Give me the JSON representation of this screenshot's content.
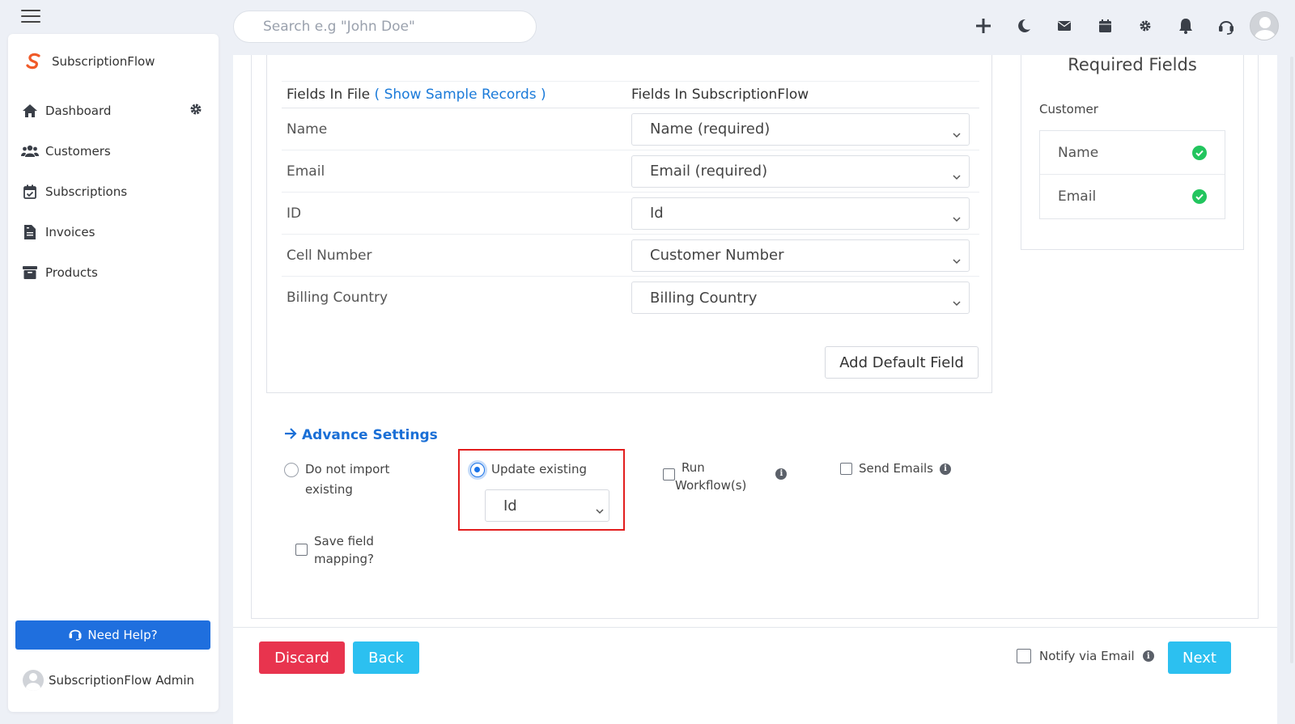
{
  "brand": {
    "name": "SubscriptionFlow",
    "accent": "#f05a28"
  },
  "search": {
    "placeholder": "Search e.g \"John Doe\""
  },
  "sidebar": {
    "items": [
      {
        "label": "Dashboard",
        "icon": "home-icon"
      },
      {
        "label": "Customers",
        "icon": "users-icon"
      },
      {
        "label": "Subscriptions",
        "icon": "calendar-check-icon"
      },
      {
        "label": "Invoices",
        "icon": "invoice-icon"
      },
      {
        "label": "Products",
        "icon": "archive-icon"
      }
    ],
    "help_label": "Need Help?",
    "admin_name": "SubscriptionFlow Admin"
  },
  "mapping": {
    "head_file": "Fields In File",
    "head_link": "( Show Sample Records )",
    "head_sf": "Fields In SubscriptionFlow",
    "rows": [
      {
        "file": "Name",
        "sf": "Name (required)"
      },
      {
        "file": "Email",
        "sf": "Email (required)"
      },
      {
        "file": "ID",
        "sf": "Id"
      },
      {
        "file": "Cell Number",
        "sf": "Customer Number"
      },
      {
        "file": "Billing Country",
        "sf": "Billing Country"
      }
    ],
    "add_default": "Add Default Field"
  },
  "required": {
    "title": "Required Fields",
    "group": "Customer",
    "items": [
      "Name",
      "Email"
    ],
    "check_color": "#22c55e"
  },
  "advance": {
    "title": "Advance Settings",
    "opt_no_import_1": "Do not import",
    "opt_no_import_2": "existing",
    "opt_update": "Update existing",
    "update_key": "Id",
    "opt_workflow_1": "Run",
    "opt_workflow_2": "Workflow(s)",
    "opt_emails": "Send Emails",
    "opt_save_1": "Save field",
    "opt_save_2": "mapping?"
  },
  "footer": {
    "discard": "Discard",
    "back": "Back",
    "notify": "Notify via Email",
    "next": "Next"
  }
}
